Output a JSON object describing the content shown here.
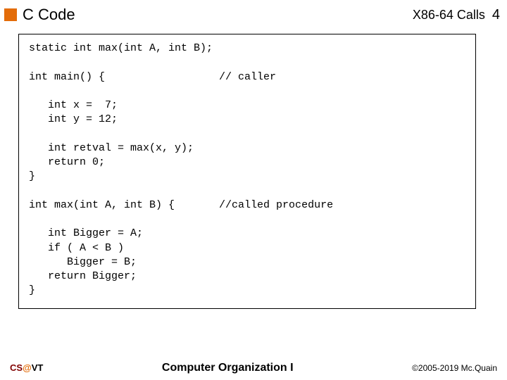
{
  "header": {
    "title": "C Code",
    "topic": "X86-64 Calls",
    "pagenum": "4"
  },
  "code": {
    "line01": "static int max(int A, int B);",
    "line02": "",
    "line03": "int main() {                  // caller",
    "line04": "",
    "line05": "   int x =  7;",
    "line06": "   int y = 12;",
    "line07": "",
    "line08": "   int retval = max(x, y);",
    "line09": "   return 0;",
    "line10": "}",
    "line11": "",
    "line12": "int max(int A, int B) {       //called procedure",
    "line13": "",
    "line14": "   int Bigger = A;",
    "line15": "   if ( A < B )",
    "line16": "      Bigger = B;",
    "line17": "   return Bigger;",
    "line18": "}"
  },
  "footer": {
    "left_cs": "CS",
    "left_at": "@",
    "left_vt": "VT",
    "center": "Computer Organization I",
    "right": "©2005-2019 Mc.Quain"
  }
}
